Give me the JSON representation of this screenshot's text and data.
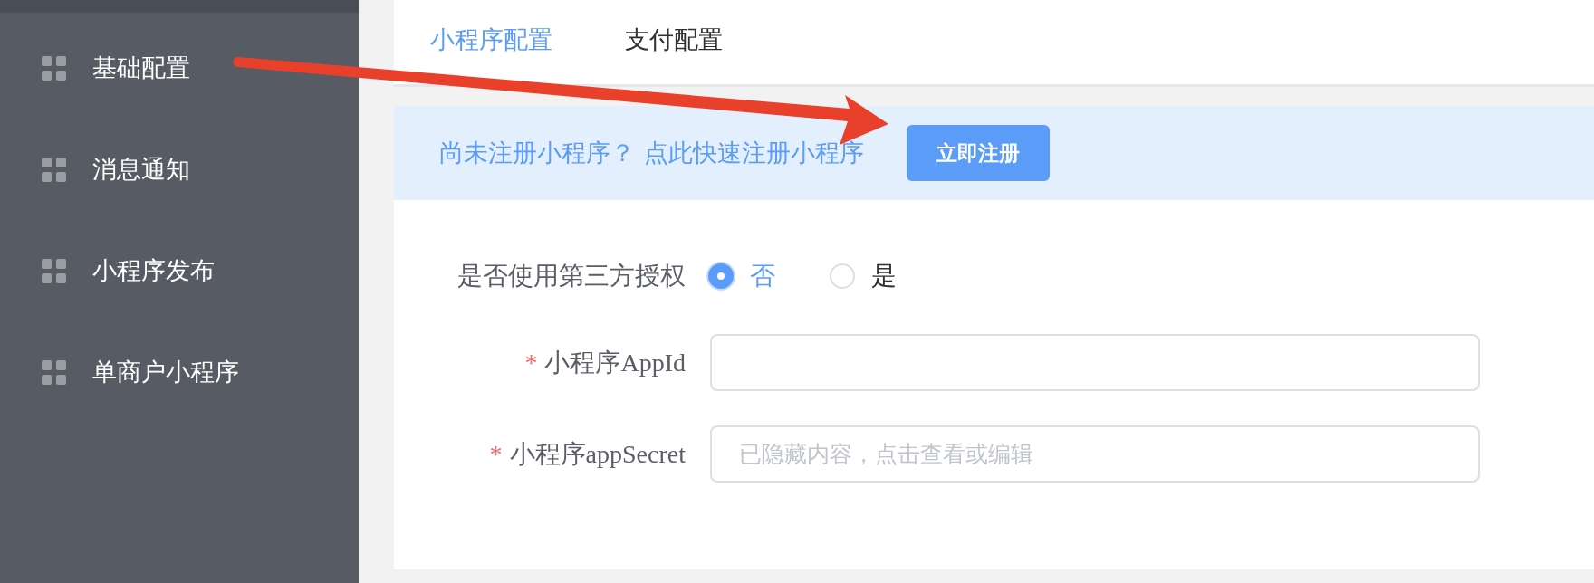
{
  "sidebar": {
    "items": [
      {
        "label": "基础配置",
        "selected": false
      },
      {
        "label": "消息通知",
        "selected": false
      },
      {
        "label": "小程序发布",
        "selected": false
      },
      {
        "label": "单商户小程序",
        "selected": false
      }
    ]
  },
  "tabs": [
    {
      "label": "小程序配置",
      "selected": true
    },
    {
      "label": "支付配置",
      "selected": false
    }
  ],
  "banner": {
    "prompt": "尚未注册小程序？",
    "link": "点此快速注册小程序",
    "button": "立即注册"
  },
  "form": {
    "auth": {
      "label": "是否使用第三方授权",
      "options": [
        {
          "label": "否",
          "selected": true
        },
        {
          "label": "是",
          "selected": false
        }
      ]
    },
    "fields": [
      {
        "required_mark": "*",
        "label": "小程序AppId"
      },
      {
        "required_mark": "*",
        "label": "小程序appSecret",
        "placeholder": "已隐藏内容，点击查看或编辑"
      }
    ]
  }
}
